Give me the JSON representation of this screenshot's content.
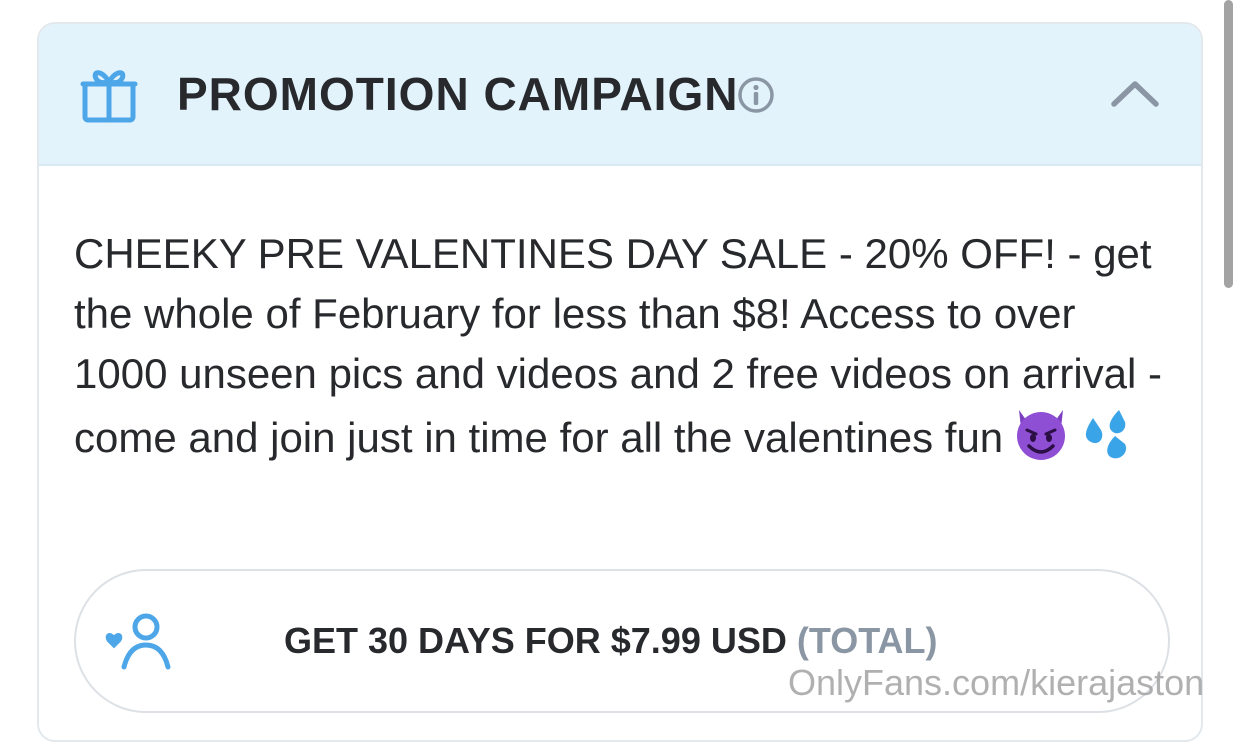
{
  "header": {
    "title": "PROMOTION CAMPAIGN",
    "icon": "gift-icon",
    "info_icon": "info-icon",
    "toggle_icon": "chevron-up-icon"
  },
  "promotion": {
    "description": "CHEEKY PRE VALENTINES DAY SALE - 20% OFF! - get the whole of February for less than $8! Access to over 1000 unseen pics and videos and 2 free videos on arrival - come and join just in time for all the valentines fun",
    "emojis": [
      "smiling-devil-emoji",
      "sweat-droplets-emoji"
    ]
  },
  "subscribe": {
    "label": "GET 30 DAYS FOR $7.99 USD",
    "suffix": "(TOTAL)",
    "icon": "subscribe-user-icon"
  },
  "watermark": "OnlyFans.com/kierajaston",
  "colors": {
    "accent": "#4da6e8",
    "header_bg": "#e2f3fb",
    "text": "#27292d",
    "muted": "#8a96a3"
  }
}
